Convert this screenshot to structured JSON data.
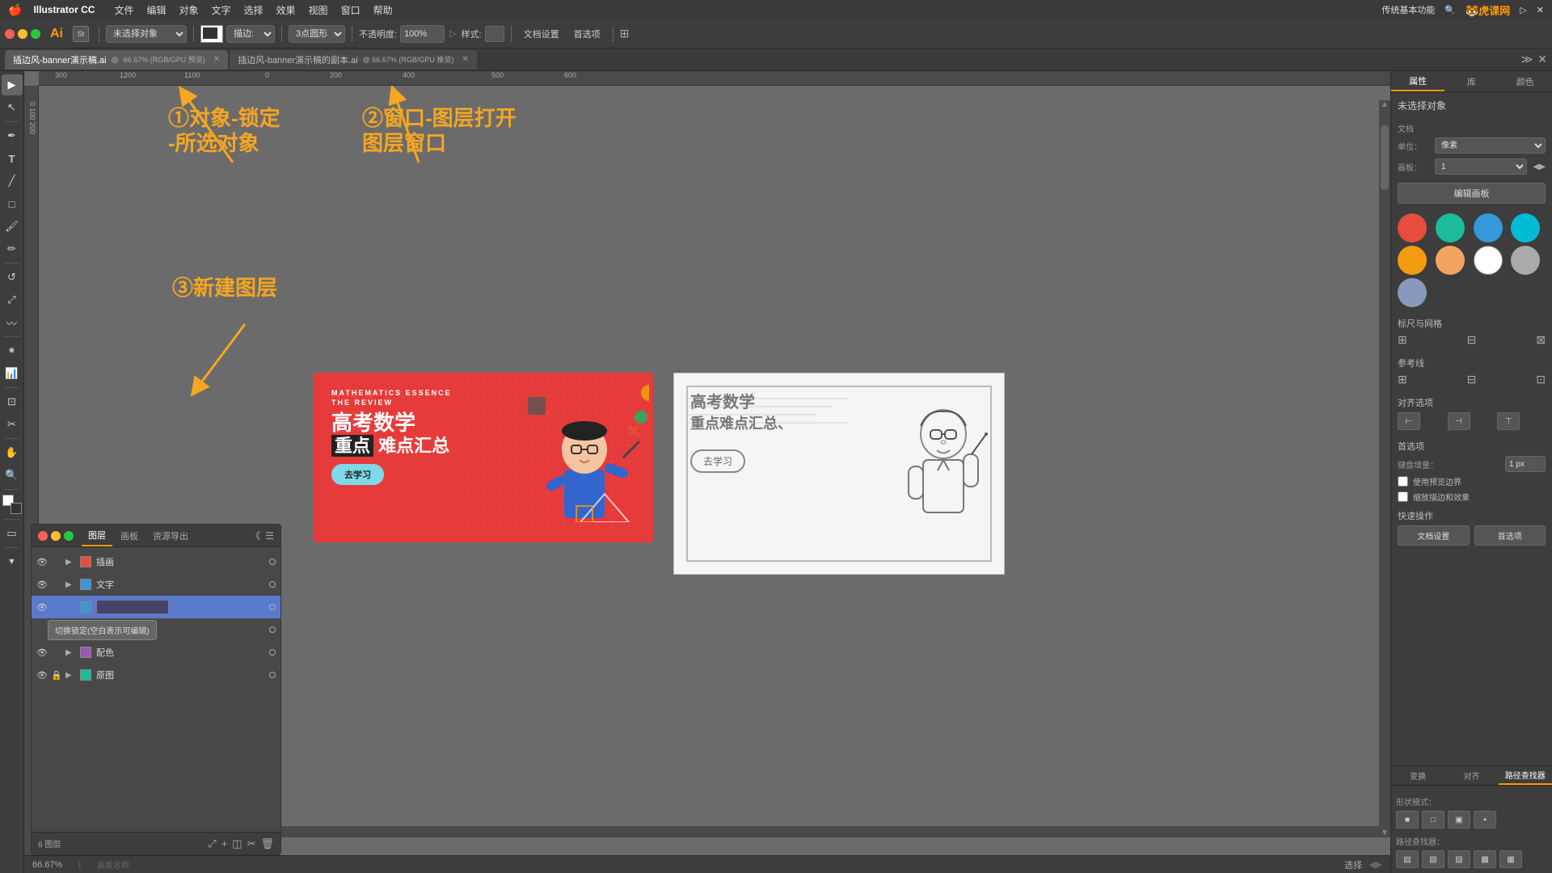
{
  "app": {
    "name": "Illustrator CC",
    "logo": "Ai"
  },
  "menu": {
    "apple": "🍎",
    "items": [
      "文件",
      "编辑",
      "对象",
      "文字",
      "选择",
      "效果",
      "视图",
      "窗口",
      "帮助"
    ]
  },
  "toolbar": {
    "unselected_label": "未选择对象",
    "stroke_label": "描边:",
    "shape_label": "3点圆形",
    "opacity_label": "不透明度:",
    "opacity_value": "100%",
    "style_label": "样式:",
    "doc_settings_label": "文档设置",
    "preferences_label": "首选项"
  },
  "tabs": [
    {
      "name": "插边风-banner演示稿.ai",
      "zoom": "66.67%",
      "mode": "RGB/GPU",
      "active": true
    },
    {
      "name": "插边风-banner演示稿的副本.ai",
      "zoom": "66.67%",
      "mode": "RGB/GPU 预览",
      "active": false
    }
  ],
  "annotations": {
    "step1": "①对象-锁定\n-所选对象",
    "step2": "②窗口-图层打开\n图层窗口",
    "step3": "③新建图层"
  },
  "layers_panel": {
    "title": "图层",
    "tabs": [
      "图层",
      "画板",
      "资源导出"
    ],
    "layers": [
      {
        "name": "插画",
        "visible": true,
        "locked": false,
        "color": "#e74c3c",
        "expanded": false
      },
      {
        "name": "文字",
        "visible": true,
        "locked": false,
        "color": "#3498db",
        "expanded": false
      },
      {
        "name": "",
        "visible": true,
        "locked": false,
        "color": "#3498db",
        "active": true,
        "editing": true
      },
      {
        "name": "配色",
        "visible": true,
        "locked": false,
        "color": "#9b59b6",
        "expanded": false,
        "sub": true
      },
      {
        "name": "配色",
        "visible": true,
        "locked": false,
        "color": "#9b59b6",
        "expanded": false
      },
      {
        "name": "原图",
        "visible": true,
        "locked": true,
        "color": "#1abc9c",
        "expanded": false
      }
    ],
    "footer": {
      "count": "6 图层",
      "new_layer_btn": "+",
      "delete_btn": "🗑"
    },
    "tooltip": "切换锁定(空白表示可编辑)"
  },
  "right_panel": {
    "tabs": [
      "属性",
      "库",
      "颜色"
    ],
    "unselected": "未选择对象",
    "document_section": "文档",
    "unit_label": "单位：",
    "unit_value": "像素",
    "artboard_label": "画板：",
    "artboard_value": "1",
    "edit_board_btn": "编辑画板",
    "colors": [
      "#e74c3c",
      "#1abc9c",
      "#3498db",
      "#00bcd4",
      "#f39c12",
      "#f4a460",
      "#ffffff",
      "#aaaaaa",
      "#8899bb"
    ],
    "scale_label": "标尺与网格",
    "guides_label": "参考线",
    "align_label": "对齐选项",
    "first_label": "首选项",
    "keyboard_nudge_label": "键盘增量：",
    "keyboard_nudge_value": "1 px",
    "checkbox1": "使用预览边界",
    "checkbox2": "缩放描边和效果",
    "quick_ops_label": "快速操作",
    "doc_settings_btn": "文档设置",
    "preferences_btn": "首选项"
  },
  "right_bottom": {
    "tabs": [
      "变换",
      "对齐",
      "路径查找器"
    ],
    "active_tab": "路径查找器",
    "shape_mode_label": "形状模式：",
    "shape_modes": [
      "■",
      "□",
      "▣",
      "▪"
    ],
    "pathfinder_label": "路径查找器：",
    "pathfinders": [
      "▤",
      "▧",
      "▨",
      "▩",
      "▦"
    ]
  },
  "status_bar": {
    "zoom": "66.67%",
    "art_info": "选择"
  }
}
